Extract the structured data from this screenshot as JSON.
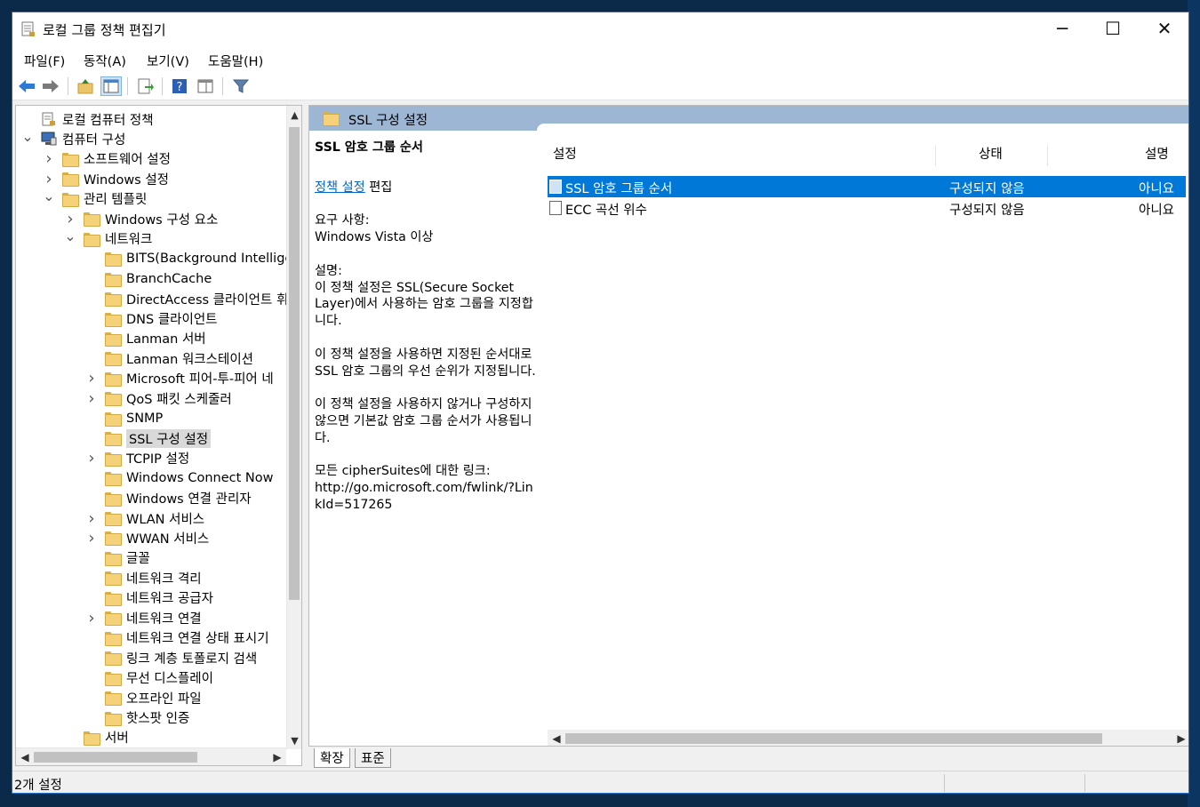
{
  "window": {
    "title": "로컬 그룹 정책 편집기",
    "controls": {
      "minimize": "─",
      "maximize": "☐",
      "close": "✕"
    }
  },
  "menu": [
    "파일(F)",
    "동작(A)",
    "보기(V)",
    "도움말(H)"
  ],
  "toolbar_icons": [
    "back-arrow-icon",
    "forward-arrow-icon",
    "up-folder-icon",
    "show-hide-tree-icon",
    "export-list-icon",
    "help-icon",
    "properties-icon",
    "filter-icon"
  ],
  "tree": [
    {
      "label": "로컬 컴퓨터 정책",
      "level": 0,
      "expander": "",
      "icon": "policy-icon"
    },
    {
      "label": "컴퓨터 구성",
      "level": 0,
      "expander": "v",
      "icon": "computer-icon"
    },
    {
      "label": "소프트웨어 설정",
      "level": 1,
      "expander": ">",
      "icon": "folder-icon"
    },
    {
      "label": "Windows 설정",
      "level": 1,
      "expander": ">",
      "icon": "folder-icon"
    },
    {
      "label": "관리 템플릿",
      "level": 1,
      "expander": "v",
      "icon": "folder-icon"
    },
    {
      "label": "Windows 구성 요소",
      "level": 2,
      "expander": ">",
      "icon": "folder-icon"
    },
    {
      "label": "네트워크",
      "level": 2,
      "expander": "v",
      "icon": "folder-icon"
    },
    {
      "label": "BITS(Background Intelliger",
      "level": 3,
      "expander": "",
      "icon": "folder-icon"
    },
    {
      "label": "BranchCache",
      "level": 3,
      "expander": "",
      "icon": "folder-icon"
    },
    {
      "label": "DirectAccess 클라이언트 휘",
      "level": 3,
      "expander": "",
      "icon": "folder-icon"
    },
    {
      "label": "DNS 클라이언트",
      "level": 3,
      "expander": "",
      "icon": "folder-icon"
    },
    {
      "label": "Lanman 서버",
      "level": 3,
      "expander": "",
      "icon": "folder-icon"
    },
    {
      "label": "Lanman 워크스테이션",
      "level": 3,
      "expander": "",
      "icon": "folder-icon"
    },
    {
      "label": "Microsoft 피어-투-피어 네",
      "level": 3,
      "expander": ">",
      "icon": "folder-icon"
    },
    {
      "label": "QoS 패킷 스케줄러",
      "level": 3,
      "expander": ">",
      "icon": "folder-icon"
    },
    {
      "label": "SNMP",
      "level": 3,
      "expander": "",
      "icon": "folder-icon"
    },
    {
      "label": "SSL 구성 설정",
      "level": 3,
      "expander": "",
      "icon": "folder-icon",
      "selected": true
    },
    {
      "label": "TCPIP 설정",
      "level": 3,
      "expander": ">",
      "icon": "folder-icon"
    },
    {
      "label": "Windows Connect Now",
      "level": 3,
      "expander": "",
      "icon": "folder-icon"
    },
    {
      "label": "Windows 연결 관리자",
      "level": 3,
      "expander": "",
      "icon": "folder-icon"
    },
    {
      "label": "WLAN 서비스",
      "level": 3,
      "expander": ">",
      "icon": "folder-icon"
    },
    {
      "label": "WWAN 서비스",
      "level": 3,
      "expander": ">",
      "icon": "folder-icon"
    },
    {
      "label": "글꼴",
      "level": 3,
      "expander": "",
      "icon": "folder-icon"
    },
    {
      "label": "네트워크 격리",
      "level": 3,
      "expander": "",
      "icon": "folder-icon"
    },
    {
      "label": "네트워크 공급자",
      "level": 3,
      "expander": "",
      "icon": "folder-icon"
    },
    {
      "label": "네트워크 연결",
      "level": 3,
      "expander": ">",
      "icon": "folder-icon"
    },
    {
      "label": "네트워크 연결 상태 표시기",
      "level": 3,
      "expander": "",
      "icon": "folder-icon"
    },
    {
      "label": "링크 계층 토폴로지 검색",
      "level": 3,
      "expander": "",
      "icon": "folder-icon"
    },
    {
      "label": "무선 디스플레이",
      "level": 3,
      "expander": "",
      "icon": "folder-icon"
    },
    {
      "label": "오프라인 파일",
      "level": 3,
      "expander": "",
      "icon": "folder-icon"
    },
    {
      "label": "핫스팟 인증",
      "level": 3,
      "expander": "",
      "icon": "folder-icon"
    },
    {
      "label": "서버",
      "level": 2,
      "expander": "",
      "icon": "folder-icon"
    }
  ],
  "right_pane": {
    "header_title": "SSL 구성 설정",
    "description": {
      "heading": "SSL 암호 그룹 순서",
      "edit_link": "정책 설정",
      "edit_suffix": " 편집",
      "requirements_label": "요구 사항:",
      "requirements_value": "Windows Vista 이상",
      "explanation_label": "설명:",
      "paragraph1": "이 정책 설정은 SSL(Secure Socket Layer)에서 사용하는 암호 그룹을 지정합니다.",
      "paragraph2": "이 정책 설정을 사용하면 지정된 순서대로 SSL 암호 그룹의 우선 순위가 지정됩니다.",
      "paragraph3": "이 정책 설정을 사용하지 않거나 구성하지 않으면 기본값 암호 그룹 순서가 사용됩니다.",
      "link_label": "모든 cipherSuites에 대한 링크:",
      "link_url": "http://go.microsoft.com/fwlink/?LinkId=517265"
    },
    "columns": [
      "설정",
      "상태",
      "설명"
    ],
    "rows": [
      {
        "setting": "SSL 암호 그룹 순서",
        "state": "구성되지 않음",
        "comment": "아니요",
        "selected": true
      },
      {
        "setting": "ECC 곡선 위수",
        "state": "구성되지 않음",
        "comment": "아니요",
        "selected": false
      }
    ]
  },
  "tabs": [
    "확장",
    "표준"
  ],
  "status": {
    "text": "2개 설정"
  },
  "colors": {
    "selection": "#0078d7",
    "header": "#9cb6d4",
    "window_border": "#1b73c7",
    "link": "#0066cc"
  }
}
